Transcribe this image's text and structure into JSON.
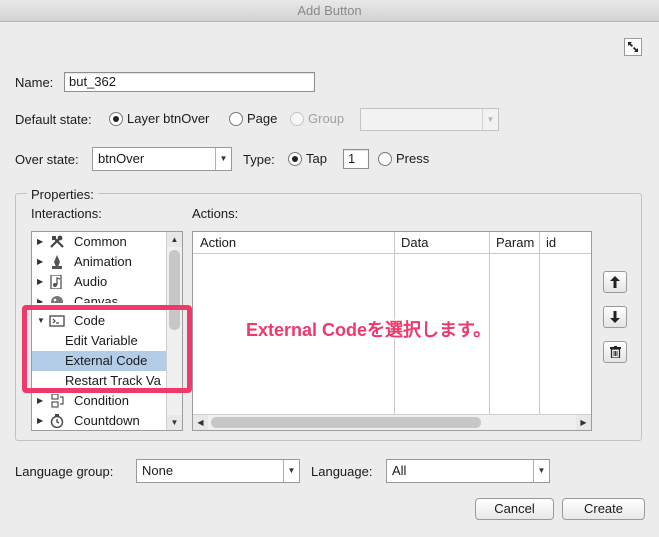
{
  "window": {
    "title": "Add Button"
  },
  "name_field": {
    "label": "Name:",
    "value": "but_362"
  },
  "default_state": {
    "label": "Default state:",
    "options": [
      {
        "label": "Layer btnOver",
        "selected": true,
        "disabled": false
      },
      {
        "label": "Page",
        "selected": false,
        "disabled": false
      },
      {
        "label": "Group",
        "selected": false,
        "disabled": true
      }
    ],
    "group_select_value": ""
  },
  "over_state": {
    "label": "Over state:",
    "value": "btnOver"
  },
  "type": {
    "label": "Type:",
    "tap_label": "Tap",
    "tap_count": "1",
    "press_label": "Press",
    "selected": "Tap"
  },
  "properties": {
    "legend": "Properties:",
    "interactions_label": "Interactions:",
    "actions_label": "Actions:",
    "interactions": [
      {
        "label": "Common",
        "kind": "category",
        "icon": "tools-icon",
        "expanded": false
      },
      {
        "label": "Animation",
        "kind": "category",
        "icon": "animation-icon",
        "expanded": false
      },
      {
        "label": "Audio",
        "kind": "category",
        "icon": "audio-icon",
        "expanded": false
      },
      {
        "label": "Canvas",
        "kind": "category",
        "icon": "canvas-icon",
        "expanded": false
      },
      {
        "label": "Code",
        "kind": "category",
        "icon": "code-icon",
        "expanded": true
      },
      {
        "label": "Edit Variable",
        "kind": "child",
        "selected": false
      },
      {
        "label": "External Code",
        "kind": "child",
        "selected": true
      },
      {
        "label": "Restart Track Va",
        "kind": "child",
        "selected": false
      },
      {
        "label": "Condition",
        "kind": "category",
        "icon": "condition-icon",
        "expanded": false
      },
      {
        "label": "Countdown",
        "kind": "category",
        "icon": "countdown-icon",
        "expanded": false
      }
    ],
    "actions_columns": [
      "Action",
      "Data",
      "Param",
      "id"
    ]
  },
  "language_group": {
    "label": "Language group:",
    "value": "None"
  },
  "language": {
    "label": "Language:",
    "value": "All"
  },
  "buttons": {
    "cancel": "Cancel",
    "create": "Create"
  },
  "annotation": {
    "text": "External Codeを選択します。",
    "color": "#f0386b"
  }
}
